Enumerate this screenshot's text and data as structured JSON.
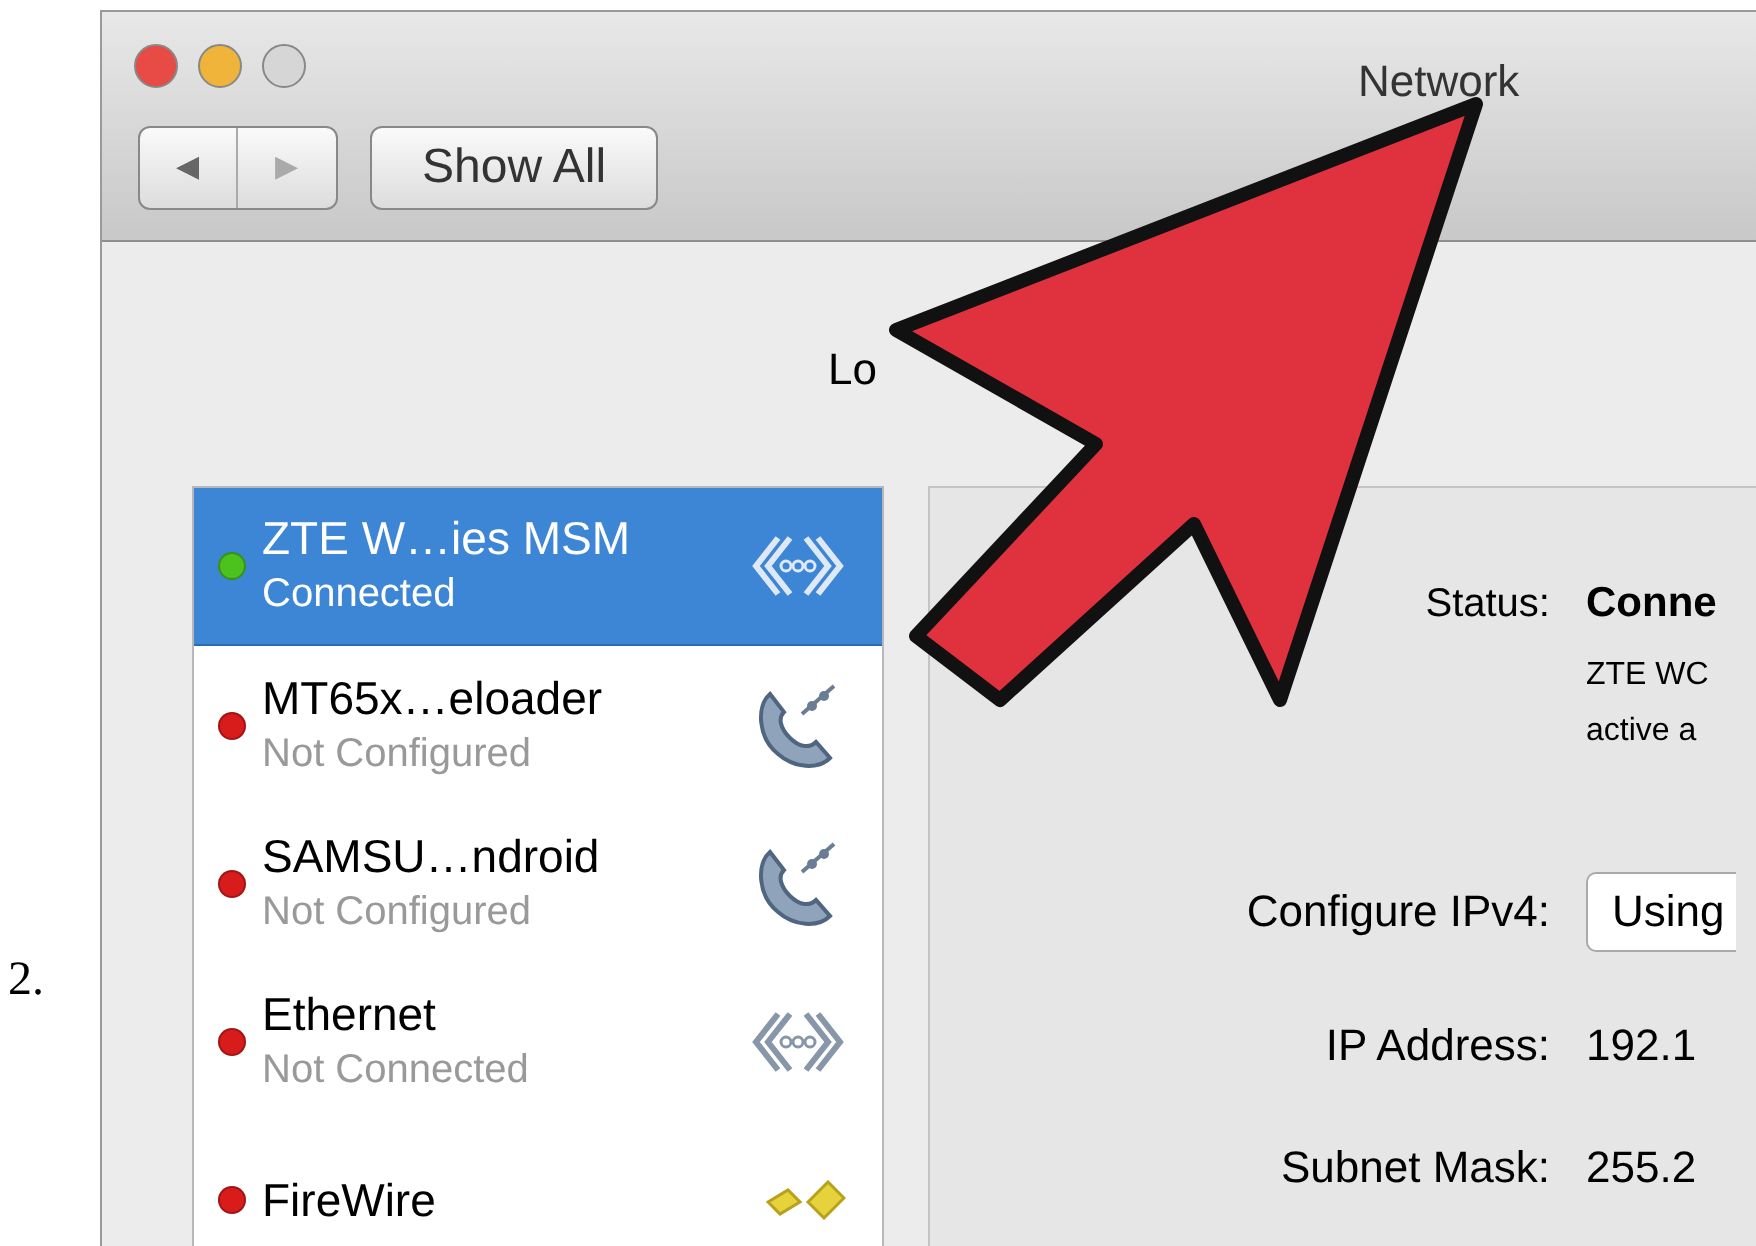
{
  "step_number": "2.",
  "window": {
    "title": "Network",
    "nav_back": "◀",
    "nav_forward": "▶",
    "show_all": "Show All"
  },
  "location_label": "Lo",
  "services": [
    {
      "name": "ZTE W…ies MSM",
      "status": "Connected",
      "color": "#4cc21f",
      "kind": "bridge",
      "selected": true
    },
    {
      "name": "MT65x…eloader",
      "status": "Not Configured",
      "color": "#d81c1c",
      "kind": "phone",
      "selected": false
    },
    {
      "name": "SAMSU…ndroid",
      "status": "Not Configured",
      "color": "#d81c1c",
      "kind": "phone",
      "selected": false
    },
    {
      "name": "Ethernet",
      "status": "Not Connected",
      "color": "#d81c1c",
      "kind": "bridge",
      "selected": false
    },
    {
      "name": "FireWire",
      "color": "#d81c1c",
      "kind": "firewire",
      "selected": false
    }
  ],
  "detail": {
    "status_label": "Status:",
    "status_value": "Conne",
    "status_description": [
      "ZTE WC",
      "active a"
    ],
    "rows": [
      {
        "kind": "popup",
        "label": "Configure IPv4:",
        "value": "Using"
      },
      {
        "kind": "text",
        "label": "IP Address:",
        "value": "192.1"
      },
      {
        "kind": "text",
        "label": "Subnet Mask:",
        "value": "255.2"
      }
    ]
  }
}
